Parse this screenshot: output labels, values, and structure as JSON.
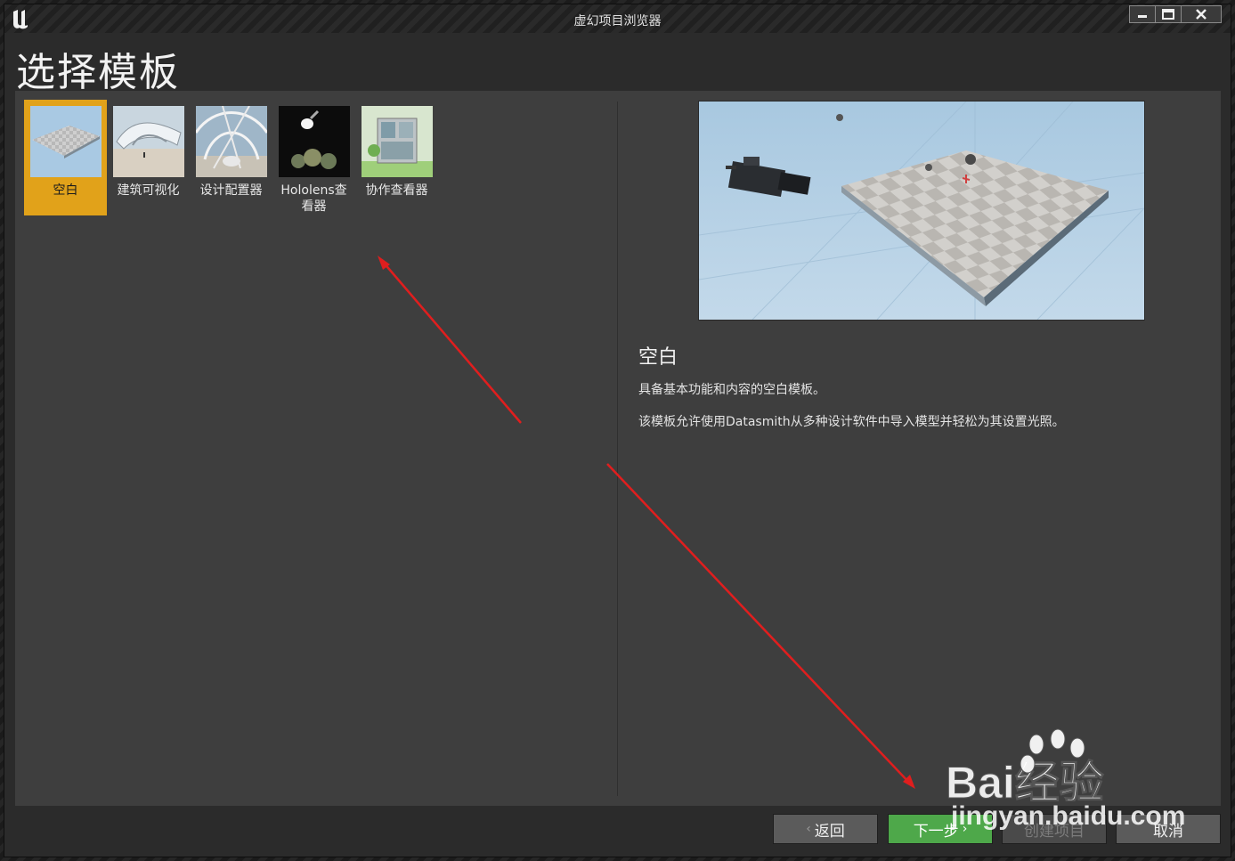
{
  "window": {
    "title": "虚幻项目浏览器"
  },
  "page": {
    "title": "选择模板"
  },
  "templates": [
    {
      "label": "空白",
      "selected": true,
      "thumb": "blank-checker-plane"
    },
    {
      "label": "建筑可视化",
      "selected": false,
      "thumb": "arch-viz-structure"
    },
    {
      "label": "设计配置器",
      "selected": false,
      "thumb": "design-configurator"
    },
    {
      "label": "Hololens查看器",
      "selected": false,
      "thumb": "hololens-viewer"
    },
    {
      "label": "协作查看器",
      "selected": false,
      "thumb": "collab-viewer"
    }
  ],
  "details": {
    "title": "空白",
    "line1": "具备基本功能和内容的空白模板。",
    "line2": "该模板允许使用Datasmith从多种设计软件中导入模型并轻松为其设置光照。"
  },
  "buttons": {
    "back": "返回",
    "next": "下一步",
    "create": "创建项目",
    "cancel": "取消"
  },
  "watermark": {
    "brand": "Bai经验",
    "url": "jingyan.baidu.com"
  },
  "colors": {
    "selected": "#e1a21a",
    "next": "#4ea84a",
    "annotation": "#e01e1e"
  }
}
